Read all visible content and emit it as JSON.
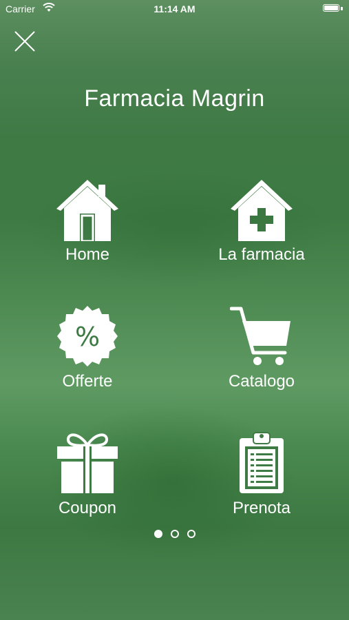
{
  "status_bar": {
    "carrier": "Carrier",
    "time": "11:14 AM"
  },
  "header": {
    "title": "Farmacia Magrin"
  },
  "menu": [
    {
      "label": "Home",
      "icon": "house-icon"
    },
    {
      "label": "La farmacia",
      "icon": "pharmacy-cross-house-icon"
    },
    {
      "label": "Offerte",
      "icon": "percent-badge-icon"
    },
    {
      "label": "Catalogo",
      "icon": "shopping-cart-icon"
    },
    {
      "label": "Coupon",
      "icon": "gift-icon"
    },
    {
      "label": "Prenota",
      "icon": "clipboard-icon"
    }
  ],
  "pager": {
    "pages": 3,
    "active_page": 1
  },
  "colors": {
    "background": "#3e7a43",
    "foreground": "#ffffff"
  }
}
